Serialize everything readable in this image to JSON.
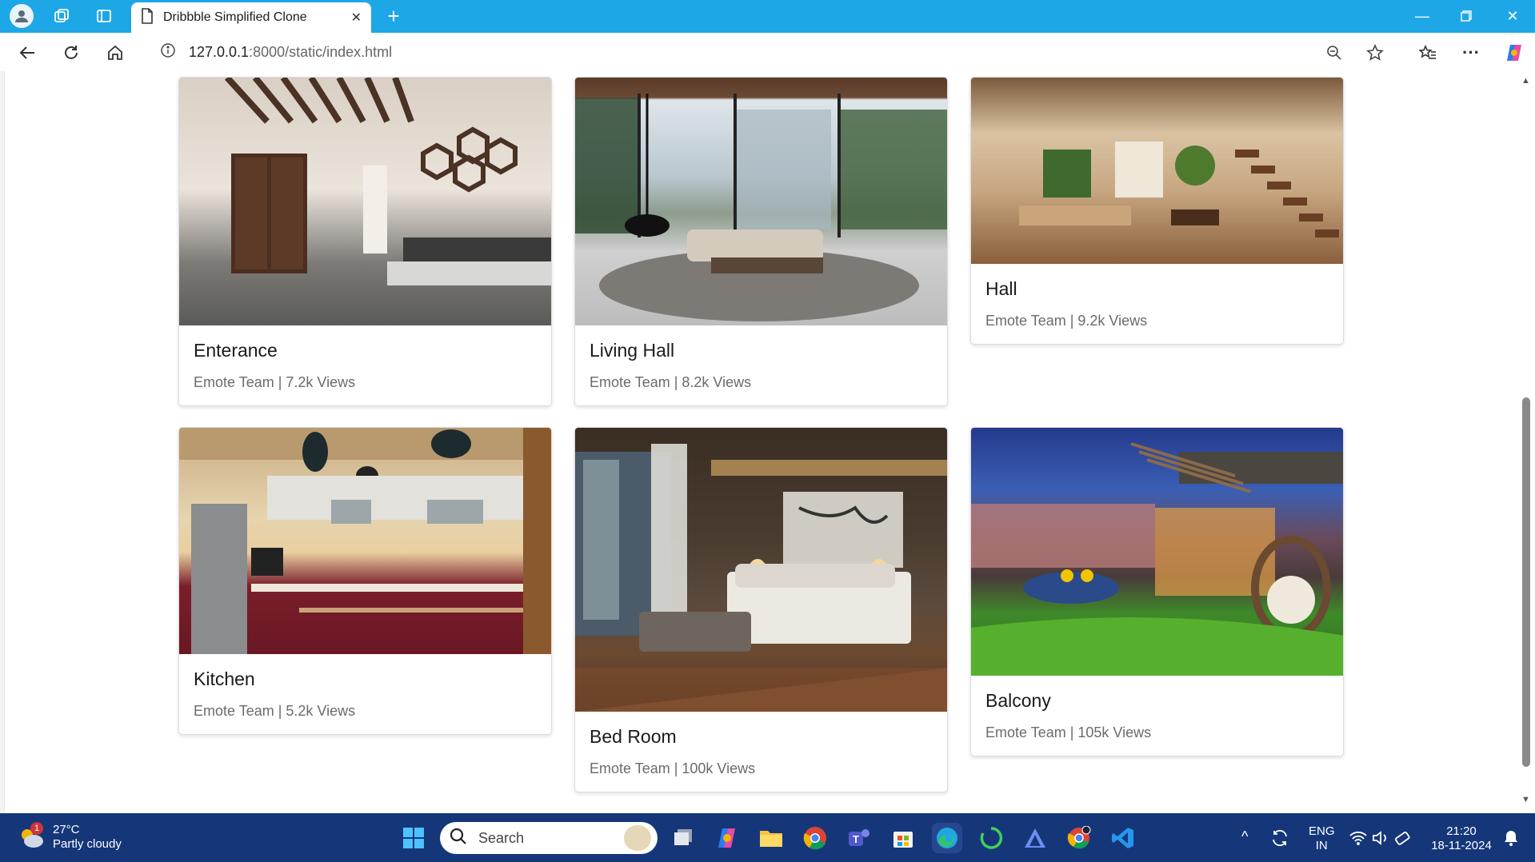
{
  "browser": {
    "tab_title": "Dribbble Simplified Clone",
    "url_host": "127.0.0.1",
    "url_rest": ":8000/static/index.html"
  },
  "cards": [
    {
      "title": "Enterance",
      "meta": "Emote Team | 7.2k Views"
    },
    {
      "title": "Living Hall",
      "meta": "Emote Team | 8.2k Views"
    },
    {
      "title": "Hall",
      "meta": "Emote Team | 9.2k Views"
    },
    {
      "title": "Kitchen",
      "meta": "Emote Team | 5.2k Views"
    },
    {
      "title": "Bed Room",
      "meta": "Emote Team | 100k Views"
    },
    {
      "title": "Balcony",
      "meta": "Emote Team | 105k Views"
    }
  ],
  "taskbar": {
    "weather_temp": "27°C",
    "weather_desc": "Partly cloudy",
    "weather_badge": "1",
    "search_label": "Search",
    "lang_top": "ENG",
    "lang_bottom": "IN",
    "time": "21:20",
    "date": "18-11-2024"
  }
}
